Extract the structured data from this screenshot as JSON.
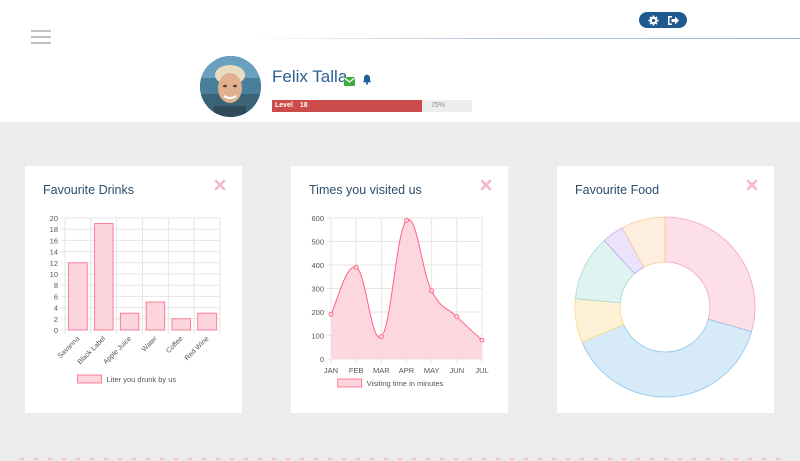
{
  "header": {
    "menu_icon": "hamburger-icon",
    "settings_icon": "gear-icon",
    "logout_icon": "sign-out-icon"
  },
  "profile": {
    "name": "Felix Talla",
    "mail_icon": "envelope-icon",
    "bell_icon": "bell-icon",
    "level_label": "Level",
    "level_value": "18",
    "progress_percent_text": "75%",
    "progress_fraction": 0.75
  },
  "colors": {
    "accent": "#1e5a8f",
    "level_bar": "#cc4b4b",
    "title": "#2c4e6e",
    "pink_stroke": "#ff6384",
    "pink_fill": "#fdd5de"
  },
  "cards": {
    "drinks": {
      "title": "Favourite Drinks",
      "close_icon": "close-icon"
    },
    "visits": {
      "title": "Times you visited us",
      "close_icon": "close-icon"
    },
    "food": {
      "title": "Favourite Food",
      "close_icon": "close-icon"
    }
  },
  "chart_data": [
    {
      "type": "bar",
      "title": "Favourite Drinks",
      "categories": [
        "Savanna",
        "Black Label",
        "Apple Juice",
        "Water",
        "Coffee",
        "Red Wine"
      ],
      "series": [
        {
          "name": "Liter you drunk by us",
          "values": [
            12,
            19,
            3,
            5,
            2,
            3
          ]
        }
      ],
      "ylim": [
        0,
        20
      ],
      "yticks": [
        0,
        2,
        4,
        6,
        8,
        10,
        12,
        14,
        16,
        18,
        20
      ],
      "grid": true,
      "legend": "bottom"
    },
    {
      "type": "area",
      "title": "Times you visited us",
      "categories": [
        "JAN",
        "FEB",
        "MAR",
        "APR",
        "MAY",
        "JUN",
        "JUL"
      ],
      "series": [
        {
          "name": "Visiting time in minutes",
          "values": [
            190,
            390,
            95,
            590,
            290,
            180,
            80
          ]
        }
      ],
      "ylim": [
        0,
        600
      ],
      "yticks": [
        0,
        100,
        200,
        300,
        400,
        500,
        600
      ],
      "grid": true,
      "legend": "bottom"
    },
    {
      "type": "pie",
      "title": "Favourite Food",
      "donut": true,
      "values": [
        30,
        40,
        8,
        12,
        4,
        8
      ],
      "colors": [
        "#fde0e7",
        "#d6eaf8",
        "#fdf2d5",
        "#dff3f1",
        "#ebe3fb",
        "#fdeedd"
      ],
      "strokes": [
        "#f6a3b4",
        "#8ec5ea",
        "#f8d98a",
        "#9fdad2",
        "#bda8ee",
        "#f8c89b"
      ]
    }
  ]
}
